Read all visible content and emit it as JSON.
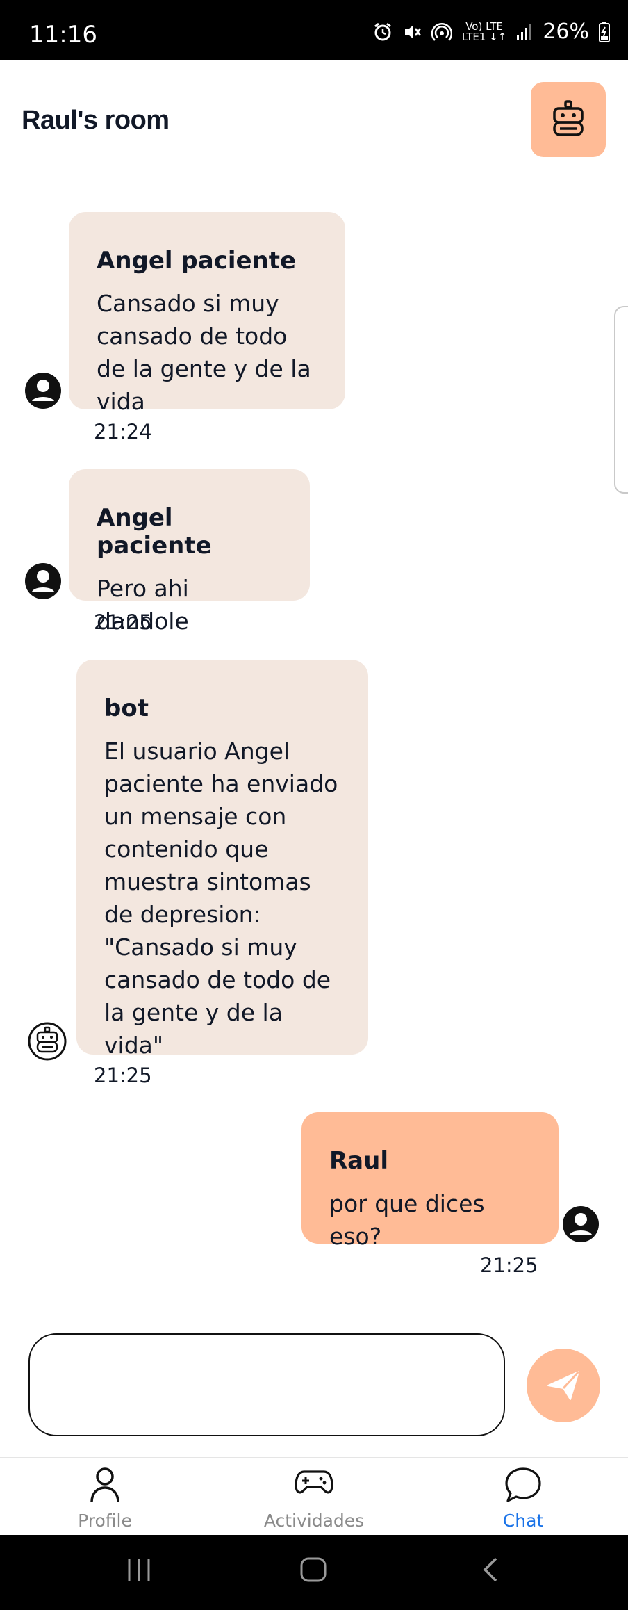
{
  "status_bar": {
    "time": "11:16",
    "lte_top": "Vo) LTE",
    "lte_bottom": "LTE1 ↓↑",
    "battery": "26%"
  },
  "header": {
    "title": "Raul's room",
    "bot_button_icon": "robot-icon"
  },
  "messages": [
    {
      "author": "Angel paciente",
      "text": "Cansado si muy cansado de todo de la gente y de la vida",
      "time": "21:24",
      "avatar": "user-avatar-icon"
    },
    {
      "author": "Angel paciente",
      "text": "Pero ahi dandole",
      "time": "21:25",
      "avatar": "user-avatar-icon"
    },
    {
      "author": "bot",
      "text": "El usuario Angel paciente ha enviado un mensaje con contenido que muestra sintomas de depresion: \"Cansado si muy cansado de todo de la gente y de la vida\"",
      "time": "21:25",
      "avatar": "robot-icon"
    },
    {
      "author": "Raul",
      "text": "por que dices eso?",
      "time": "21:25",
      "avatar": "user-avatar-icon"
    }
  ],
  "composer": {
    "value": "",
    "send_icon": "send-icon"
  },
  "tabs": [
    {
      "label": "Profile",
      "icon": "person-icon",
      "active": false
    },
    {
      "label": "Actividades",
      "icon": "gamepad-icon",
      "active": false
    },
    {
      "label": "Chat",
      "icon": "chat-bubble-icon",
      "active": true
    }
  ],
  "colors": {
    "accent": "#FFBB96",
    "bubble_other": "#F3E7DF",
    "active_tab": "#1a73e8"
  }
}
